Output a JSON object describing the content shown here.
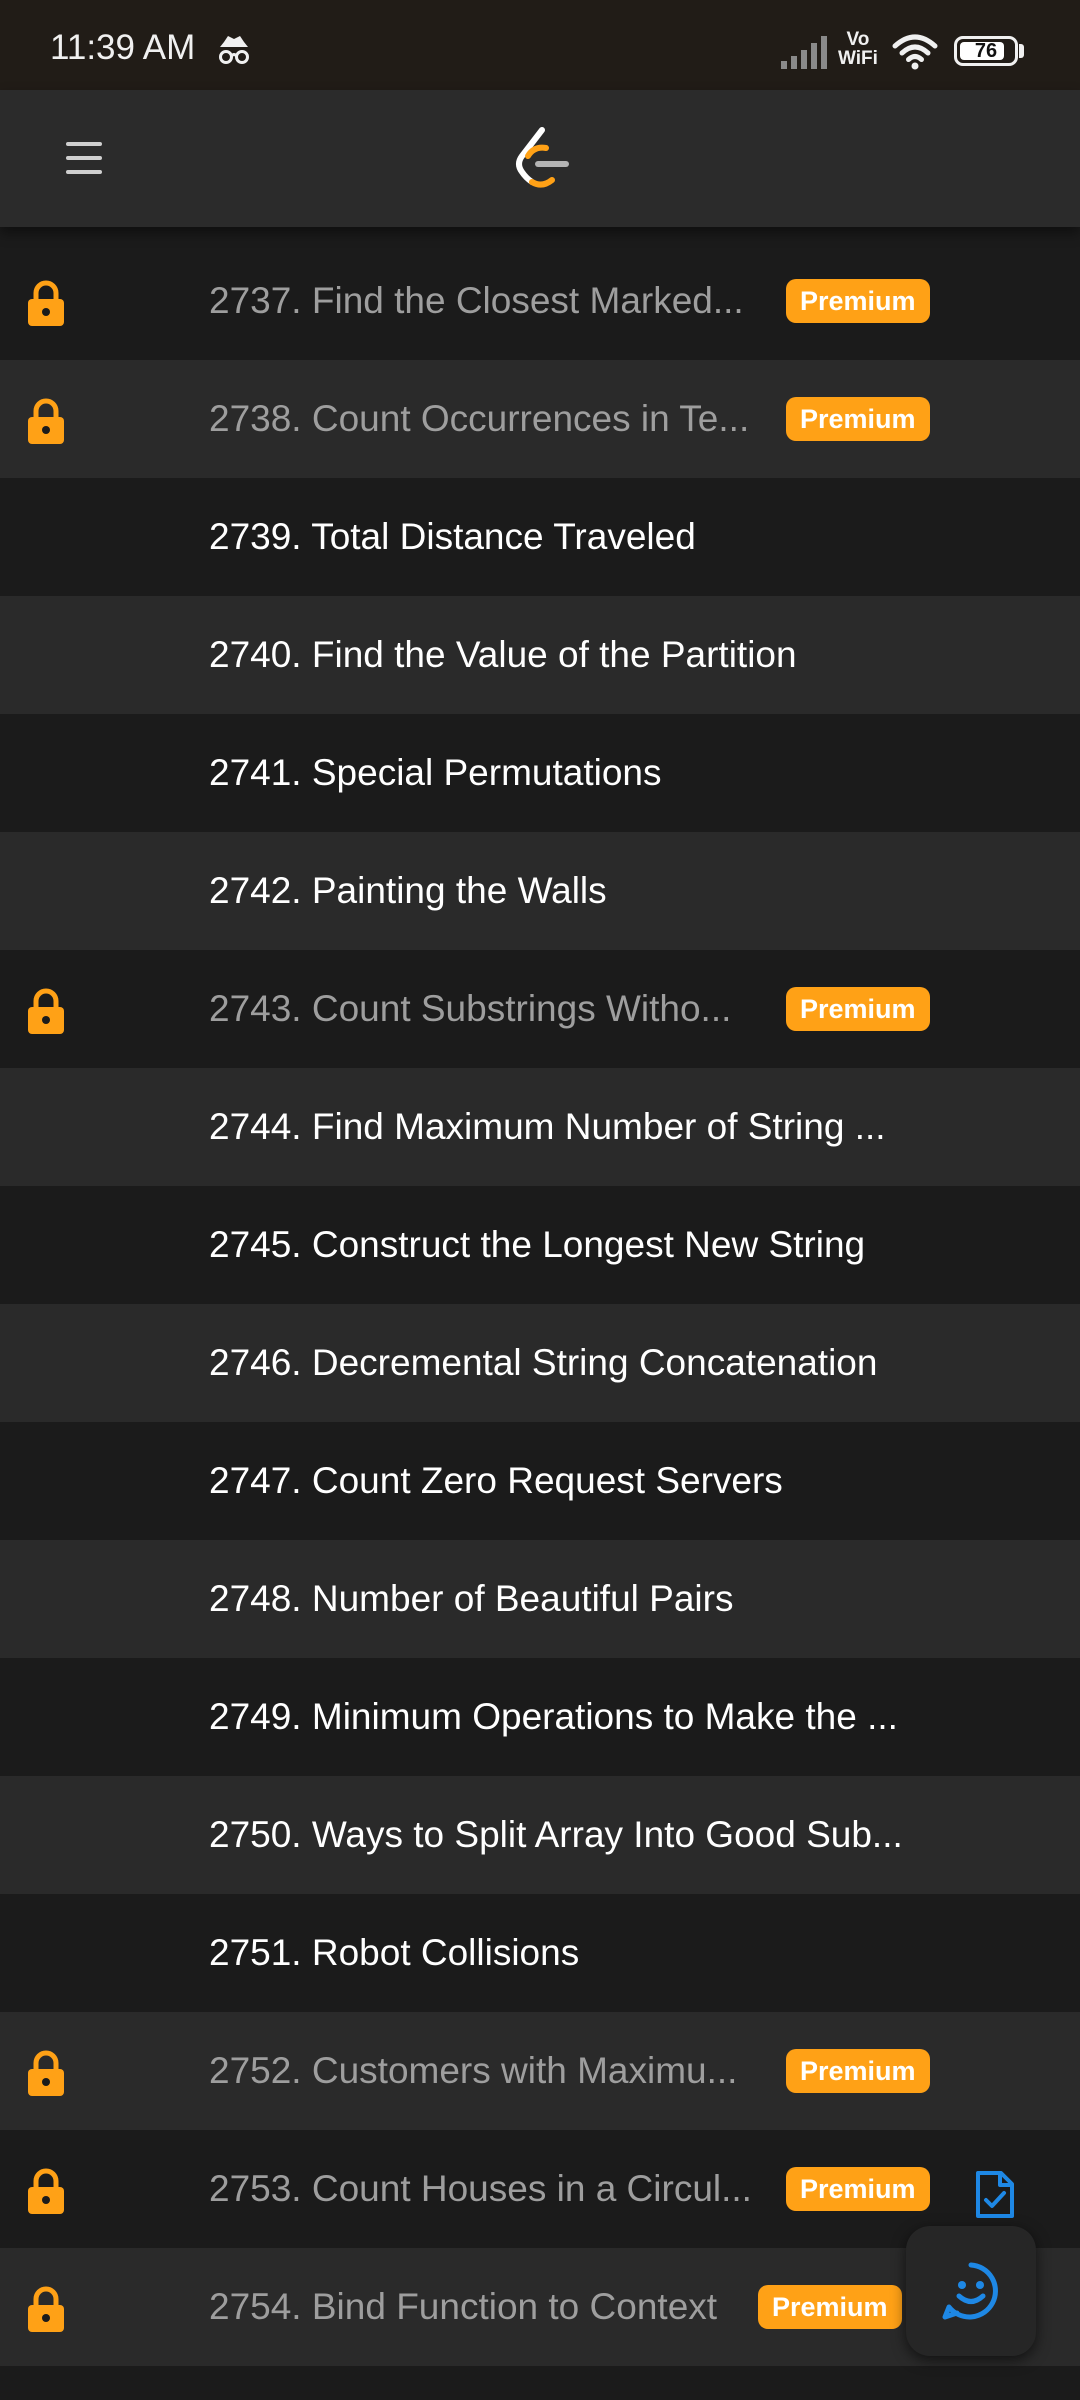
{
  "status_bar": {
    "time": "11:39 AM",
    "vo": "Vo",
    "wifi_label": "WiFi",
    "battery": "76"
  },
  "app_bar": {
    "menu_icon": "hamburger-menu-icon",
    "logo": "leetcode-logo"
  },
  "problems": [
    {
      "title": "2737. Find the Closest Marked...",
      "locked": true,
      "badge": "Premium"
    },
    {
      "title": "2738. Count Occurrences in Te...",
      "locked": true,
      "badge": "Premium"
    },
    {
      "title": "2739. Total Distance Traveled",
      "locked": false
    },
    {
      "title": "2740. Find the Value of the Partition",
      "locked": false
    },
    {
      "title": "2741. Special Permutations",
      "locked": false
    },
    {
      "title": "2742. Painting the Walls",
      "locked": false
    },
    {
      "title": "2743. Count Substrings Witho...",
      "locked": true,
      "badge": "Premium"
    },
    {
      "title": "2744. Find Maximum Number of String ...",
      "locked": false
    },
    {
      "title": "2745. Construct the Longest New String",
      "locked": false
    },
    {
      "title": "2746. Decremental String Concatenation",
      "locked": false
    },
    {
      "title": "2747. Count Zero Request Servers",
      "locked": false
    },
    {
      "title": "2748. Number of Beautiful Pairs",
      "locked": false
    },
    {
      "title": "2749. Minimum Operations to Make the ...",
      "locked": false
    },
    {
      "title": "2750. Ways to Split Array Into Good Sub...",
      "locked": false
    },
    {
      "title": "2751. Robot Collisions",
      "locked": false
    },
    {
      "title": "2752. Customers with Maximu...",
      "locked": true,
      "badge": "Premium"
    },
    {
      "title": "2753. Count Houses in a Circul...",
      "locked": true,
      "badge": "Premium"
    },
    {
      "title": "2754. Bind Function to Context",
      "locked": true,
      "badge": "Premium"
    }
  ],
  "floating": {
    "doc_icon": "document-check-icon",
    "feedback_icon": "smiley-feedback-icon"
  },
  "colors": {
    "accent": "#ffa116",
    "blue": "#1e88e5",
    "row_dark": "#1b1b1b",
    "row_light": "#2a2a2a"
  }
}
